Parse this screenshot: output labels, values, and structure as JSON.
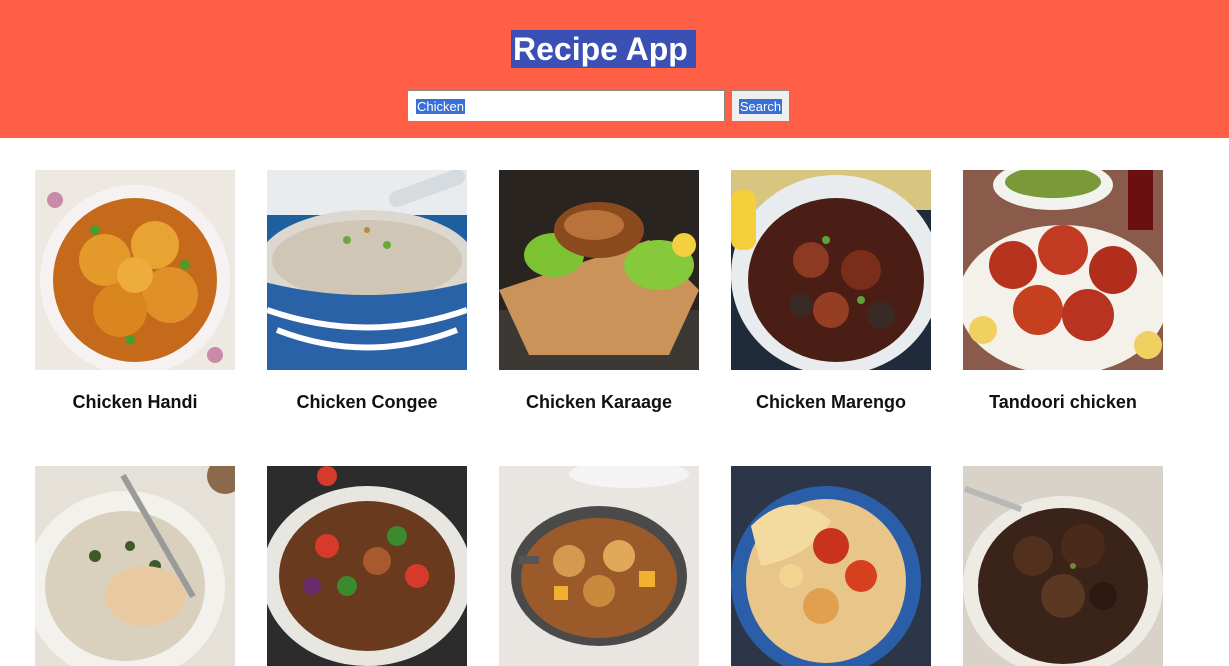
{
  "app": {
    "title": "Recipe App"
  },
  "search": {
    "value": "Chicken",
    "button_label": "Search"
  },
  "colors": {
    "header_bg": "#ff5f45",
    "selection": "#3a50b4"
  },
  "recipes": [
    {
      "name": "Chicken Handi",
      "image_icon": "chicken-curry-bowl"
    },
    {
      "name": "Chicken Congee",
      "image_icon": "congee-bowl"
    },
    {
      "name": "Chicken Karaage",
      "image_icon": "fried-chicken-lettuce"
    },
    {
      "name": "Chicken Marengo",
      "image_icon": "chicken-stew-pot"
    },
    {
      "name": "Tandoori chicken",
      "image_icon": "tandoori-plate"
    },
    {
      "name": "",
      "image_icon": "chicken-beans-dish"
    },
    {
      "name": "",
      "image_icon": "chicken-salad-plate"
    },
    {
      "name": "",
      "image_icon": "chicken-casserole"
    },
    {
      "name": "",
      "image_icon": "cheesy-bake-dish"
    },
    {
      "name": "",
      "image_icon": "dark-braised-chicken"
    }
  ]
}
